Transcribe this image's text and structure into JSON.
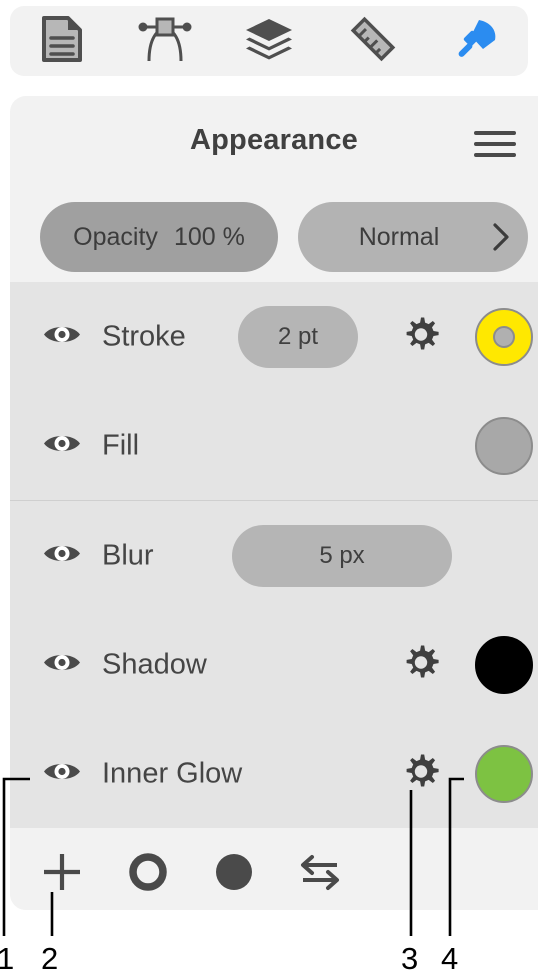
{
  "toolbar": {
    "tools": [
      {
        "name": "document-icon",
        "label": "Document",
        "active": false
      },
      {
        "name": "node-icon",
        "label": "Node",
        "active": false
      },
      {
        "name": "layers-icon",
        "label": "Layers",
        "active": false
      },
      {
        "name": "ruler-icon",
        "label": "Ruler",
        "active": false
      },
      {
        "name": "appearance-brush-icon",
        "label": "Appearance",
        "active": true
      }
    ],
    "active_color": "#2b8cf0",
    "inactive_color": "#4f4f4f"
  },
  "panel": {
    "title": "Appearance",
    "menu_icon": "hamburger-menu-icon",
    "blend": {
      "opacity_label": "Opacity",
      "opacity_value": "100 %",
      "blend_mode": "Normal",
      "chevron_icon": "chevron-right-icon"
    },
    "properties": [
      {
        "label": "Stroke",
        "visible": true,
        "value": "2 pt",
        "has_value_pill": true,
        "has_gear": true,
        "swatch": "ring",
        "swatch_color": "#ffe800",
        "divider_above": false
      },
      {
        "label": "Fill",
        "visible": true,
        "value": "",
        "has_value_pill": false,
        "has_gear": false,
        "swatch": "solid",
        "swatch_color": "#a8a8a8",
        "divider_above": false
      },
      {
        "label": "Blur",
        "visible": true,
        "value": "5 px",
        "has_value_pill": true,
        "has_gear": false,
        "swatch": "none",
        "swatch_color": "",
        "divider_above": true
      },
      {
        "label": "Shadow",
        "visible": true,
        "value": "",
        "has_value_pill": false,
        "has_gear": true,
        "swatch": "solid",
        "swatch_color": "#000000",
        "divider_above": false
      },
      {
        "label": "Inner Glow",
        "visible": true,
        "value": "",
        "has_value_pill": false,
        "has_gear": true,
        "swatch": "solid",
        "swatch_color": "#7dc242",
        "divider_above": false
      }
    ],
    "bottom_bar": [
      {
        "name": "add-effect-button",
        "icon": "plus-icon",
        "label": "Add"
      },
      {
        "name": "stroke-swatch-button",
        "icon": "ring-icon",
        "label": "Stroke"
      },
      {
        "name": "fill-swatch-button",
        "icon": "filled-circle-icon",
        "label": "Fill"
      },
      {
        "name": "swap-fill-stroke-button",
        "icon": "swap-arrows-icon",
        "label": "Swap"
      }
    ]
  },
  "annotations": [
    {
      "number": "1",
      "target": "inner-glow-visibility-eye"
    },
    {
      "number": "2",
      "target": "add-effect-button"
    },
    {
      "number": "3",
      "target": "inner-glow-gear"
    },
    {
      "number": "4",
      "target": "inner-glow-color-swatch"
    }
  ]
}
